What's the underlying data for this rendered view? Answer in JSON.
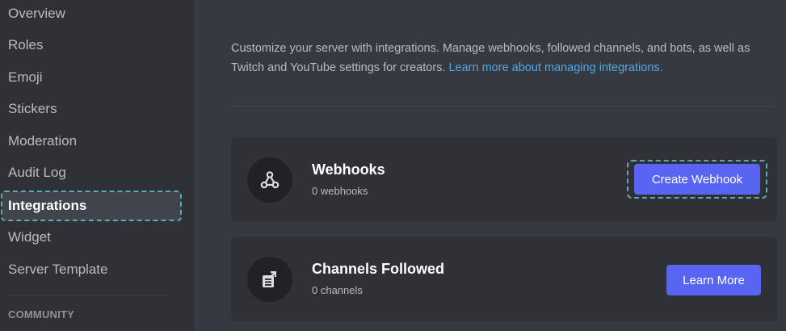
{
  "sidebar": {
    "items": [
      {
        "label": "Overview",
        "active": false
      },
      {
        "label": "Roles",
        "active": false
      },
      {
        "label": "Emoji",
        "active": false
      },
      {
        "label": "Stickers",
        "active": false
      },
      {
        "label": "Moderation",
        "active": false
      },
      {
        "label": "Audit Log",
        "active": false
      },
      {
        "label": "Integrations",
        "active": true
      },
      {
        "label": "Widget",
        "active": false
      },
      {
        "label": "Server Template",
        "active": false
      }
    ],
    "section_header": "COMMUNITY"
  },
  "main": {
    "description_text": "Customize your server with integrations. Manage webhooks, followed channels, and bots, as well as Twitch and YouTube settings for creators. ",
    "description_link": "Learn more about managing integrations.",
    "cards": [
      {
        "icon": "webhook-icon",
        "title": "Webhooks",
        "subtitle": "0 webhooks",
        "button": "Create Webhook"
      },
      {
        "icon": "channels-followed-icon",
        "title": "Channels Followed",
        "subtitle": "0 channels",
        "button": "Learn More"
      }
    ]
  },
  "colors": {
    "accent": "#5865f2",
    "link": "#4fa8e8",
    "sidebar_bg": "#2f3136",
    "main_bg": "#36393f",
    "card_bg": "#2f3136",
    "highlight_outline": "#5aa9b5"
  }
}
